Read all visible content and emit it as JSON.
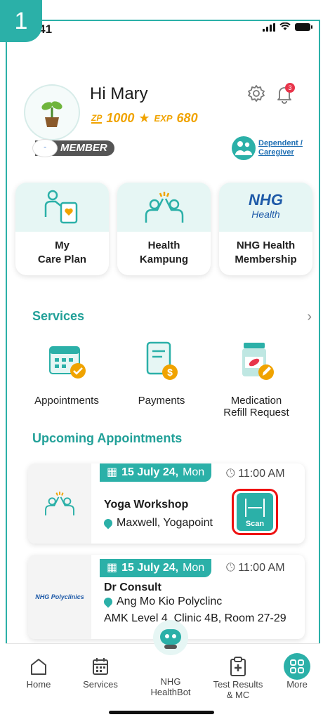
{
  "step": {
    "number": "1"
  },
  "status_bar": {
    "time": "9:41"
  },
  "header": {
    "greeting": "Hi Mary",
    "zp_label": "ZP",
    "points": "1000",
    "exp_label": "EXP",
    "exp_value": "680",
    "membership": "MEMBER",
    "notification_count": "3",
    "dependent_label_line1": "Dependent /",
    "dependent_label_line2": "Caregiver"
  },
  "tiles": [
    {
      "line1": "My",
      "line2": "Care Plan",
      "icon": "care-plan-icon"
    },
    {
      "line1": "Health",
      "line2": "Kampung",
      "icon": "community-icon"
    },
    {
      "line1": "NHG Health",
      "line2": "Membership",
      "icon": "nhg-health-logo",
      "logo_text": "NHG",
      "logo_sub": "Health"
    }
  ],
  "services": {
    "title": "Services",
    "items": [
      {
        "label": "Appointments",
        "icon": "calendar-check-icon"
      },
      {
        "label": "Payments",
        "icon": "bill-dollar-icon"
      },
      {
        "label_line1": "Medication",
        "label_line2": "Refill Request",
        "icon": "medication-refill-icon"
      }
    ]
  },
  "upcoming": {
    "title": "Upcoming Appointments",
    "appointments": [
      {
        "date": "15 July 24,",
        "day": "Mon",
        "time": "11:00 AM",
        "title": "Yoga Workshop",
        "location": "Maxwell, Yogapoint",
        "action": "Scan"
      },
      {
        "date": "15 July 24,",
        "day": "Mon",
        "time": "11:00 AM",
        "title": "Dr Consult",
        "location": "Ang Mo Kio Polyclinc",
        "detail": "AMK Level 4, Clinic 4B, Room 27-29",
        "logo_text": "NHG Polyclinics"
      }
    ]
  },
  "bottom_nav": {
    "home": "Home",
    "services": "Services",
    "bot_line1": "NHG",
    "bot_line2": "HealthBot",
    "results_line1": "Test Results",
    "results_line2": "& MC",
    "more": "More"
  },
  "colors": {
    "accent": "#2bb0a8",
    "gold": "#f0a300",
    "alert": "#e8344a",
    "highlight": "#e11111"
  }
}
